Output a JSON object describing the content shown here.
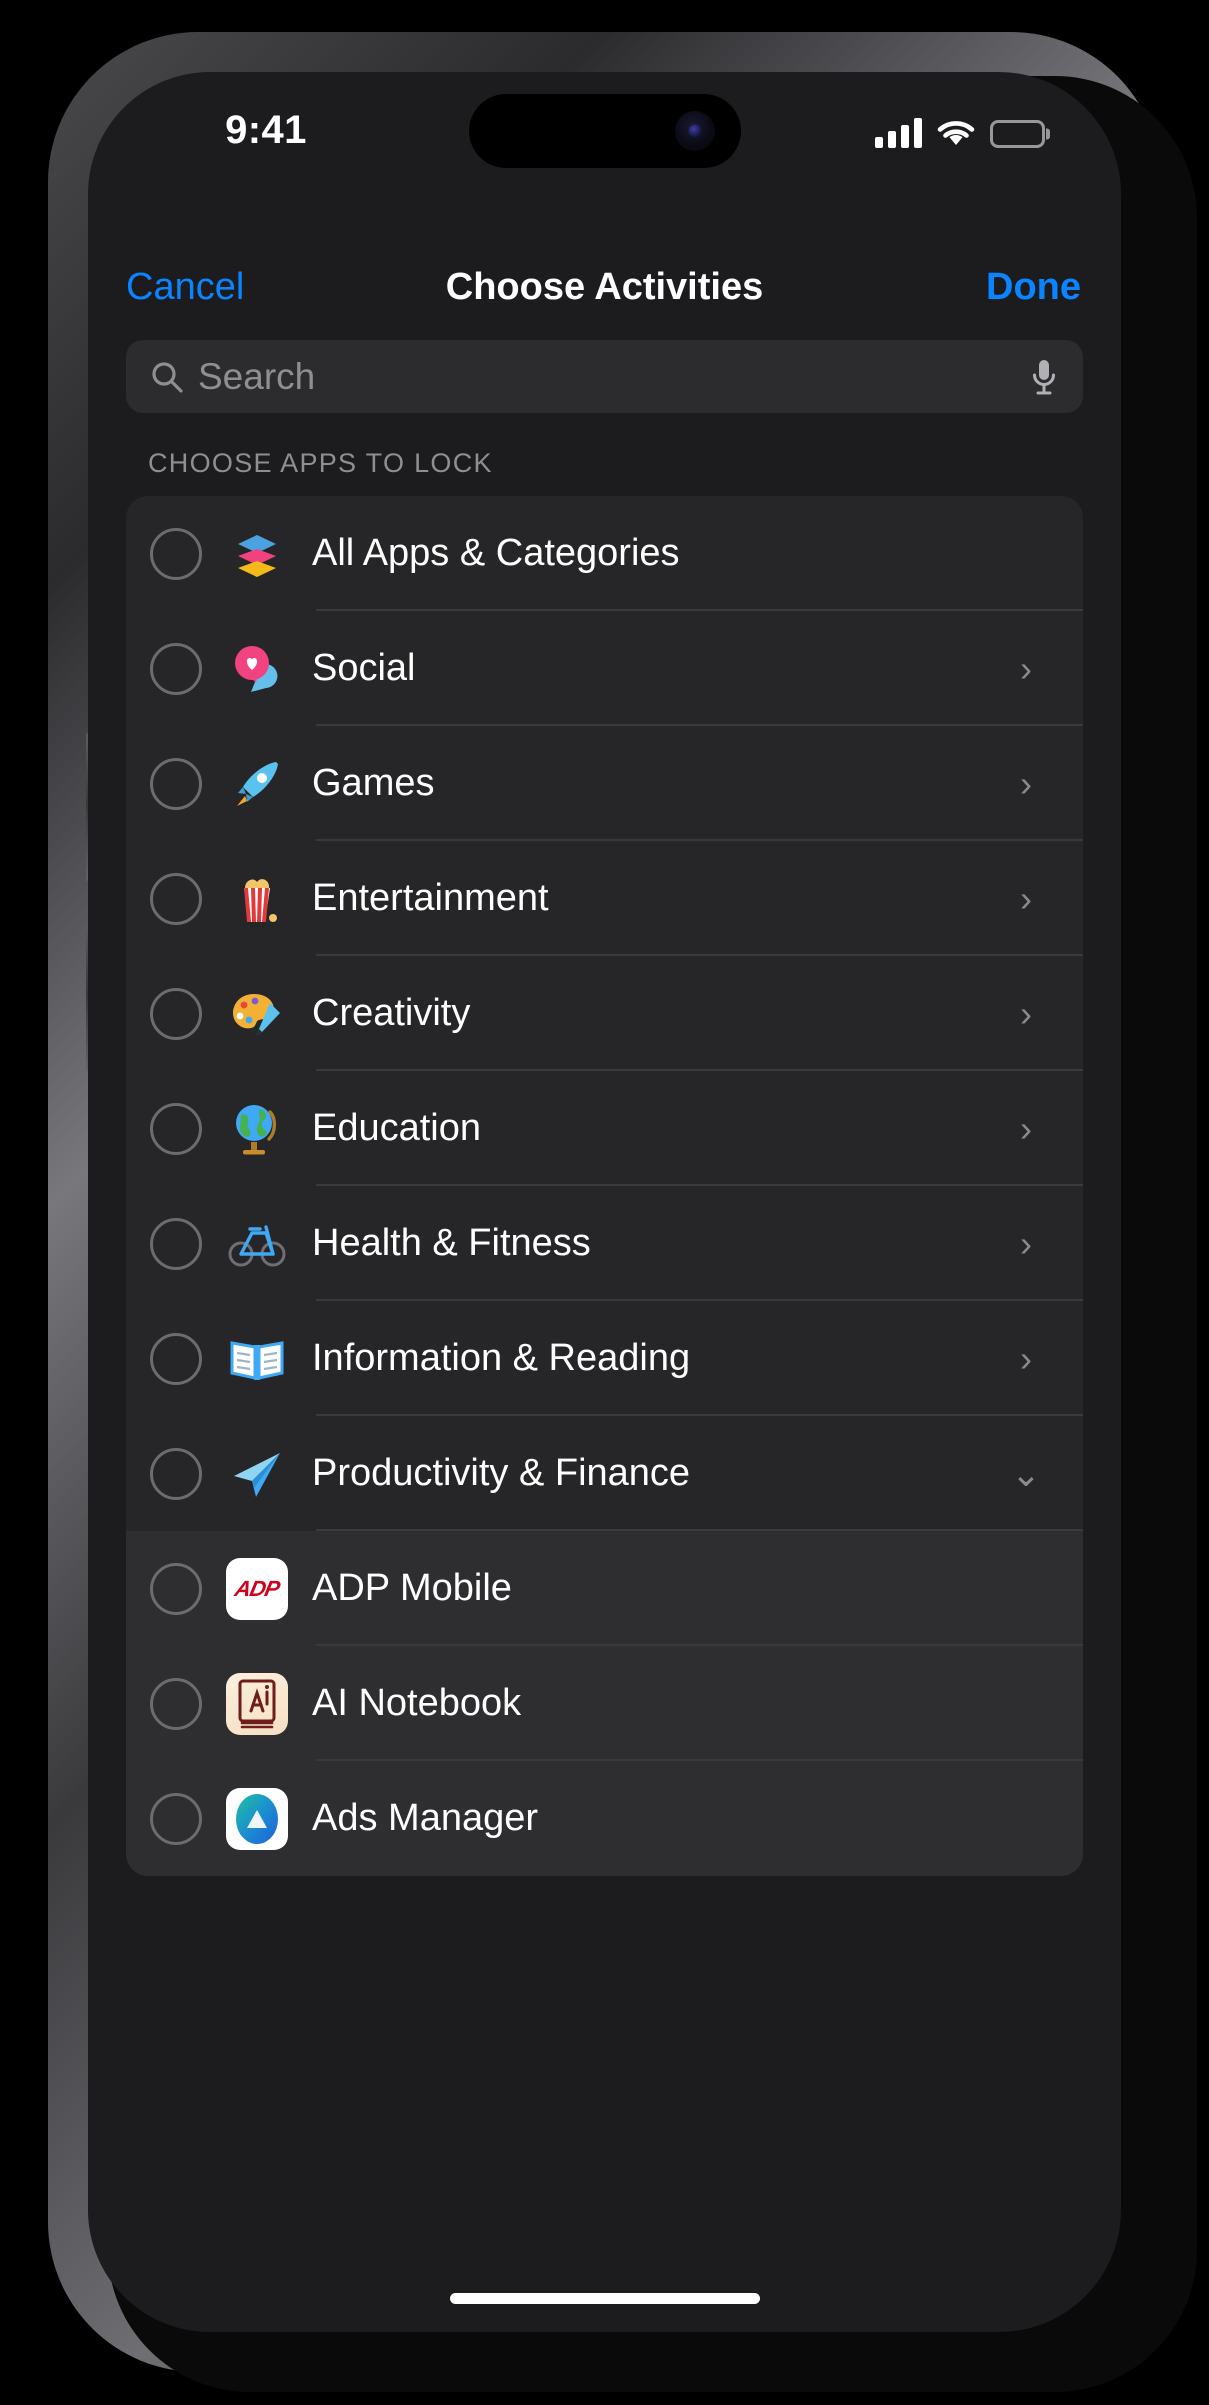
{
  "status_bar": {
    "time": "9:41",
    "signal_icon": "cellular-signal-icon",
    "wifi_icon": "wifi-icon",
    "battery_icon": "battery-full-icon"
  },
  "nav": {
    "cancel_label": "Cancel",
    "title": "Choose Activities",
    "done_label": "Done"
  },
  "search": {
    "placeholder": "Search",
    "value": "",
    "search_icon": "search-icon",
    "mic_icon": "microphone-icon"
  },
  "section": {
    "header": "CHOOSE APPS TO LOCK"
  },
  "colors": {
    "accent_blue": "#0a84ff",
    "screen_bg": "#1c1c1e",
    "card_bg": "#262628",
    "app_row_bg": "#2e2e30",
    "separator": "#3a3a3c",
    "secondary_text": "#8e8e93",
    "radio_stroke": "#6c6c70"
  },
  "rows": [
    {
      "label": "All Apps & Categories",
      "icon": "stacked-layers-icon",
      "type": "category",
      "chevron": "none",
      "selected": false
    },
    {
      "label": "Social",
      "icon": "chat-heart-icon",
      "type": "category",
      "chevron": "right",
      "selected": false
    },
    {
      "label": "Games",
      "icon": "rocket-icon",
      "type": "category",
      "chevron": "right",
      "selected": false
    },
    {
      "label": "Entertainment",
      "icon": "popcorn-icon",
      "type": "category",
      "chevron": "right",
      "selected": false
    },
    {
      "label": "Creativity",
      "icon": "palette-icon",
      "type": "category",
      "chevron": "right",
      "selected": false
    },
    {
      "label": "Education",
      "icon": "globe-icon",
      "type": "category",
      "chevron": "right",
      "selected": false
    },
    {
      "label": "Health & Fitness",
      "icon": "bicycle-icon",
      "type": "category",
      "chevron": "right",
      "selected": false
    },
    {
      "label": "Information & Reading",
      "icon": "open-book-icon",
      "type": "category",
      "chevron": "right",
      "selected": false
    },
    {
      "label": "Productivity & Finance",
      "icon": "paper-plane-icon",
      "type": "category",
      "chevron": "down",
      "selected": false
    },
    {
      "label": "ADP Mobile",
      "icon": "adp-mobile-app-icon",
      "type": "app",
      "chevron": "none",
      "selected": false
    },
    {
      "label": "AI Notebook",
      "icon": "ai-notebook-app-icon",
      "type": "app",
      "chevron": "none",
      "selected": false
    },
    {
      "label": "Ads Manager",
      "icon": "ads-manager-app-icon",
      "type": "app",
      "chevron": "none",
      "selected": false
    }
  ],
  "home_indicator": "home-indicator"
}
